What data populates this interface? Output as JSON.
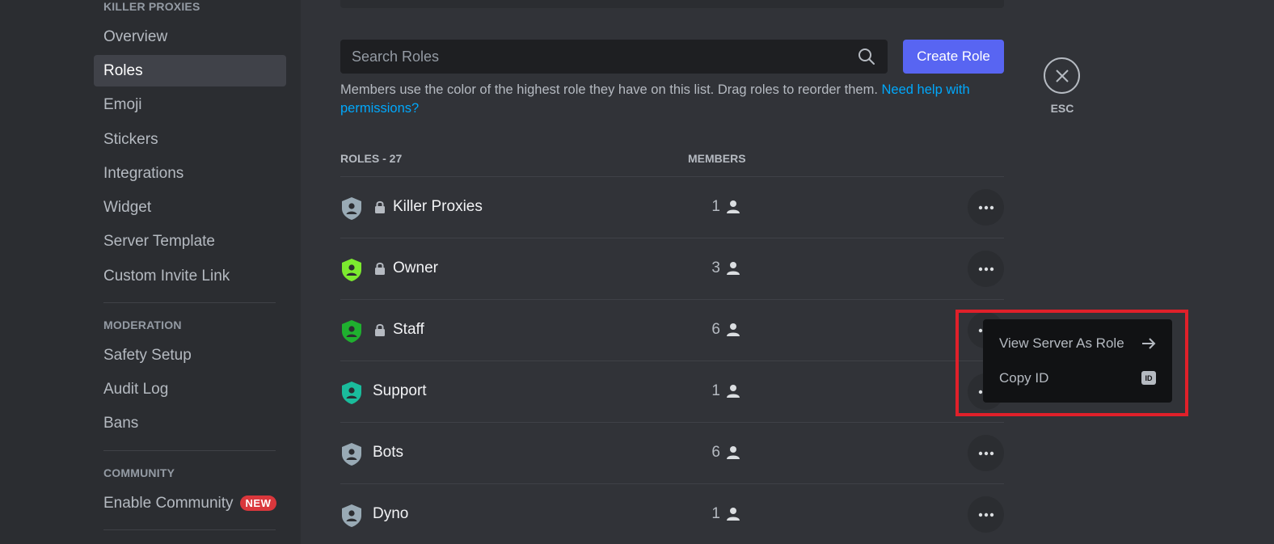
{
  "sidebar": {
    "server_header": "KILLER PROXIES",
    "items": [
      {
        "label": "Overview"
      },
      {
        "label": "Roles"
      },
      {
        "label": "Emoji"
      },
      {
        "label": "Stickers"
      },
      {
        "label": "Integrations"
      },
      {
        "label": "Widget"
      },
      {
        "label": "Server Template"
      },
      {
        "label": "Custom Invite Link"
      }
    ],
    "moderation_header": "MODERATION",
    "moderation_items": [
      {
        "label": "Safety Setup"
      },
      {
        "label": "Audit Log"
      },
      {
        "label": "Bans"
      }
    ],
    "community_header": "COMMUNITY",
    "community_item": {
      "label": "Enable Community",
      "badge": "NEW"
    }
  },
  "main": {
    "search_placeholder": "Search Roles",
    "create_button": "Create Role",
    "description": "Members use the color of the highest role they have on this list. Drag roles to reorder them.",
    "help_link": "Need help with permissions?",
    "esc_label": "ESC",
    "col_roles": "ROLES - 27",
    "col_members": "MEMBERS"
  },
  "roles": [
    {
      "name": "Killer Proxies",
      "count": "1",
      "color": "#99aab5",
      "locked": true
    },
    {
      "name": "Owner",
      "count": "3",
      "color": "#7cea2f",
      "locked": true
    },
    {
      "name": "Staff",
      "count": "6",
      "color": "#1fb02f",
      "locked": true
    },
    {
      "name": "Support",
      "count": "1",
      "color": "#1abc9c",
      "locked": false
    },
    {
      "name": "Bots",
      "count": "6",
      "color": "#99aab5",
      "locked": false
    },
    {
      "name": "Dyno",
      "count": "1",
      "color": "#99aab5",
      "locked": false
    }
  ],
  "context_menu": {
    "view_as_role": "View Server As Role",
    "copy_id": "Copy ID",
    "id_badge": "ID"
  },
  "colors": {
    "accent": "#5865f2",
    "link": "#00a8fc",
    "highlight": "#e0202a"
  }
}
